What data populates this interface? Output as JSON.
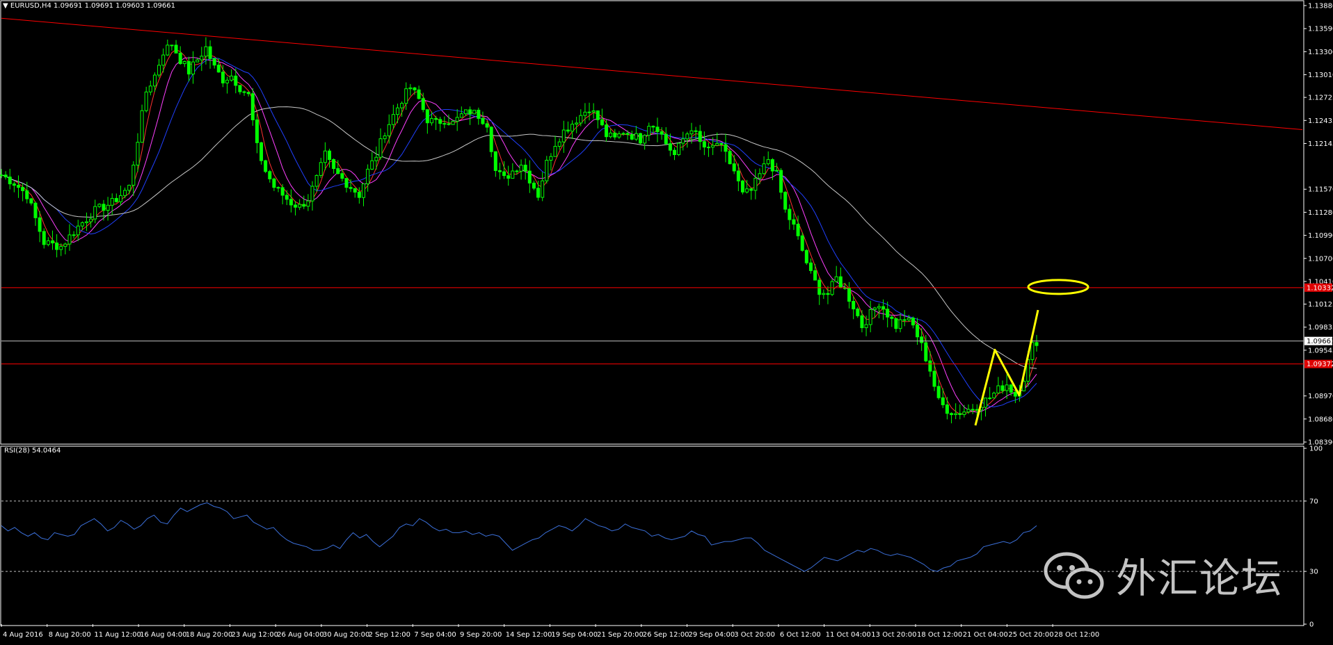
{
  "header": {
    "symbol_info": "▼ EURUSD,H4  1.09691 1.09691 1.09603 1.09661"
  },
  "rsi_panel": {
    "label": "RSI(28) 54.0464"
  },
  "watermark": {
    "text": "外汇论坛"
  },
  "colors": {
    "background": "#000000",
    "candle": "#00ff00",
    "trendline": "#ff0000",
    "level_line": "#ff0000",
    "bid_line": "#c0c0c0",
    "ma_fast": "#ff3030",
    "ma_mid": "#ff40ff",
    "ma_slow": "#2040ff",
    "ma_long": "#c8c8c8",
    "rsi": "#3b6fd8",
    "annotation": "#ffff00"
  },
  "chart_data": [
    {
      "type": "candlestick",
      "title": "EURUSD,H4",
      "ylim": [
        1.0839,
        1.1388
      ],
      "y_ticks": [
        "1.13880",
        "1.13590",
        "1.13300",
        "1.13010",
        "1.12725",
        "1.12435",
        "1.12145",
        "1.11570",
        "1.11280",
        "1.10990",
        "1.10700",
        "1.10410",
        "1.10125",
        "1.09835",
        "1.09545",
        "1.08970",
        "1.08680",
        "1.08390"
      ],
      "x_ticks": [
        "4 Aug 2016",
        "8 Aug 20:00",
        "11 Aug 12:00",
        "16 Aug 04:00",
        "18 Aug 20:00",
        "23 Aug 12:00",
        "26 Aug 04:00",
        "30 Aug 20:00",
        "2 Sep 12:00",
        "7 Sep 04:00",
        "9 Sep 20:00",
        "14 Sep 12:00",
        "19 Sep 04:00",
        "21 Sep 20:00",
        "26 Sep 12:00",
        "29 Sep 04:00",
        "3 Oct 20:00",
        "6 Oct 12:00",
        "11 Oct 04:00",
        "13 Oct 20:00",
        "18 Oct 12:00",
        "21 Oct 04:00",
        "25 Oct 20:00",
        "28 Oct 12:00"
      ],
      "price_labels": [
        {
          "value": 1.10332,
          "text": "1.10332",
          "style": "red"
        },
        {
          "value": 1.09661,
          "text": "1.09661",
          "style": "white"
        },
        {
          "value": 1.09372,
          "text": "1.09372",
          "style": "red"
        }
      ],
      "levels": [
        1.10332,
        1.09372
      ],
      "bid": 1.09661,
      "trendline": {
        "from": 1.1372,
        "to": 1.1232
      },
      "close_path": [
        [
          0,
          1.1175
        ],
        [
          3,
          1.1165
        ],
        [
          6,
          1.115
        ],
        [
          10,
          1.109
        ],
        [
          14,
          1.1085
        ],
        [
          18,
          1.111
        ],
        [
          22,
          1.113
        ],
        [
          26,
          1.114
        ],
        [
          30,
          1.116
        ],
        [
          32,
          1.122
        ],
        [
          34,
          1.128
        ],
        [
          36,
          1.13
        ],
        [
          38,
          1.133
        ],
        [
          40,
          1.134
        ],
        [
          42,
          1.132
        ],
        [
          44,
          1.1305
        ],
        [
          46,
          1.132
        ],
        [
          48,
          1.1335
        ],
        [
          50,
          1.131
        ],
        [
          52,
          1.1295
        ],
        [
          54,
          1.13
        ],
        [
          56,
          1.1285
        ],
        [
          58,
          1.1275
        ],
        [
          60,
          1.121
        ],
        [
          62,
          1.118
        ],
        [
          64,
          1.116
        ],
        [
          66,
          1.115
        ],
        [
          68,
          1.114
        ],
        [
          70,
          1.1135
        ],
        [
          72,
          1.1145
        ],
        [
          74,
          1.117
        ],
        [
          76,
          1.12
        ],
        [
          78,
          1.118
        ],
        [
          80,
          1.117
        ],
        [
          82,
          1.116
        ],
        [
          84,
          1.115
        ],
        [
          86,
          1.118
        ],
        [
          88,
          1.12
        ],
        [
          90,
          1.123
        ],
        [
          92,
          1.125
        ],
        [
          94,
          1.127
        ],
        [
          96,
          1.1285
        ],
        [
          98,
          1.127
        ],
        [
          100,
          1.1245
        ],
        [
          102,
          1.124
        ],
        [
          104,
          1.1245
        ],
        [
          106,
          1.124
        ],
        [
          108,
          1.125
        ],
        [
          110,
          1.1255
        ],
        [
          112,
          1.125
        ],
        [
          114,
          1.124
        ],
        [
          116,
          1.118
        ],
        [
          118,
          1.117
        ],
        [
          120,
          1.118
        ],
        [
          122,
          1.119
        ],
        [
          124,
          1.117
        ],
        [
          126,
          1.115
        ],
        [
          128,
          1.119
        ],
        [
          130,
          1.1215
        ],
        [
          132,
          1.123
        ],
        [
          134,
          1.124
        ],
        [
          136,
          1.125
        ],
        [
          138,
          1.126
        ],
        [
          140,
          1.1245
        ],
        [
          142,
          1.1225
        ],
        [
          144,
          1.122
        ],
        [
          146,
          1.123
        ],
        [
          148,
          1.1225
        ],
        [
          150,
          1.122
        ],
        [
          152,
          1.124
        ],
        [
          154,
          1.1235
        ],
        [
          156,
          1.1215
        ],
        [
          158,
          1.12
        ],
        [
          160,
          1.122
        ],
        [
          162,
          1.1235
        ],
        [
          164,
          1.1215
        ],
        [
          166,
          1.1205
        ],
        [
          168,
          1.1215
        ],
        [
          170,
          1.12
        ],
        [
          172,
          1.118
        ],
        [
          174,
          1.115
        ],
        [
          176,
          1.1155
        ],
        [
          178,
          1.1175
        ],
        [
          180,
          1.1195
        ],
        [
          182,
          1.1175
        ],
        [
          184,
          1.113
        ],
        [
          186,
          1.111
        ],
        [
          188,
          1.108
        ],
        [
          190,
          1.105
        ],
        [
          192,
          1.103
        ],
        [
          194,
          1.1025
        ],
        [
          196,
          1.1045
        ],
        [
          198,
          1.103
        ],
        [
          200,
          1.101
        ],
        [
          202,
          1.0985
        ],
        [
          204,
          1.1
        ],
        [
          206,
          1.1015
        ],
        [
          208,
          1.1
        ],
        [
          210,
          1.0985
        ],
        [
          212,
          1.0995
        ],
        [
          214,
          1.0985
        ],
        [
          216,
          1.096
        ],
        [
          218,
          1.093
        ],
        [
          220,
          1.089
        ],
        [
          222,
          1.088
        ],
        [
          224,
          1.0875
        ],
        [
          226,
          1.0878
        ],
        [
          228,
          1.0882
        ],
        [
          230,
          1.0888
        ],
        [
          232,
          1.0895
        ],
        [
          234,
          1.0905
        ],
        [
          236,
          1.0912
        ],
        [
          238,
          1.0898
        ],
        [
          240,
          1.092
        ],
        [
          242,
          1.096
        ],
        [
          243,
          1.0966
        ]
      ],
      "annotation": {
        "zigzag": [
          [
            1.086
          ],
          [
            1.0955
          ],
          [
            1.0898
          ],
          [
            1.1005
          ]
        ],
        "ellipse_center": 1.10332
      }
    },
    {
      "type": "line",
      "title": "RSI(28) 54.0464",
      "ylim": [
        0,
        100
      ],
      "y_ticks": [
        "100",
        "70",
        "30",
        "0"
      ],
      "levels": [
        70,
        30
      ],
      "series": [
        {
          "values": [
            56,
            53,
            55,
            52,
            50,
            52,
            49,
            48,
            52,
            51,
            50,
            51,
            56,
            58,
            60,
            57,
            53,
            55,
            59,
            57,
            54,
            56,
            60,
            62,
            58,
            57,
            62,
            66,
            64,
            66,
            68,
            69,
            67,
            66,
            64,
            60,
            61,
            62,
            58,
            56,
            54,
            55,
            51,
            48,
            46,
            45,
            44,
            42,
            42,
            43,
            45,
            43,
            48,
            52,
            49,
            51,
            47,
            44,
            47,
            50,
            55,
            57,
            56,
            60,
            58,
            55,
            53,
            54,
            52,
            52,
            53,
            51,
            52,
            50,
            51,
            50,
            46,
            42,
            44,
            46,
            48,
            49,
            52,
            54,
            56,
            55,
            53,
            56,
            60,
            58,
            56,
            55,
            53,
            54,
            57,
            55,
            54,
            53,
            50,
            51,
            49,
            48,
            49,
            50,
            53,
            51,
            50,
            45,
            46,
            47,
            47,
            48,
            49,
            49,
            46,
            42,
            40,
            38,
            36,
            34,
            32,
            30,
            32,
            35,
            38,
            37,
            36,
            38,
            40,
            42,
            41,
            43,
            42,
            40,
            39,
            40,
            39,
            38,
            36,
            34,
            31,
            30,
            32,
            33,
            36,
            37,
            38,
            40,
            44,
            45,
            46,
            47,
            46,
            48,
            52,
            53,
            56
          ]
        }
      ]
    }
  ]
}
